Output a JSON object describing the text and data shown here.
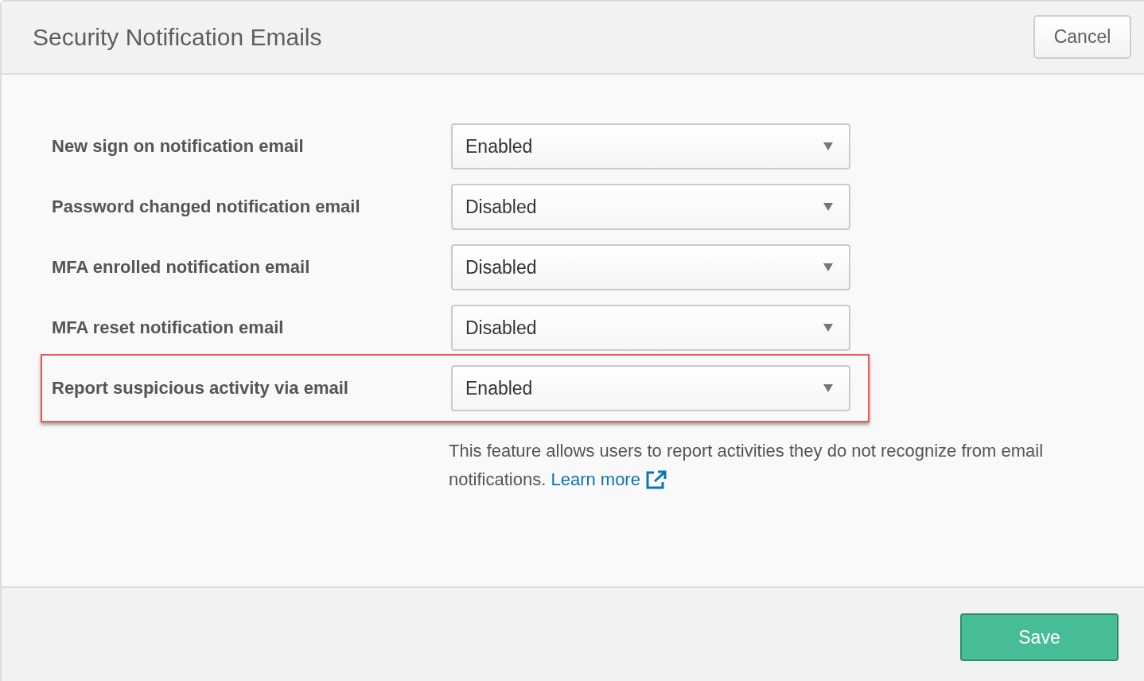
{
  "dialog": {
    "title": "Security Notification Emails",
    "cancel_button": "Cancel",
    "save_button": "Save"
  },
  "settings": [
    {
      "label": "New sign on notification email",
      "value": "Enabled",
      "highlighted": false
    },
    {
      "label": "Password changed notification email",
      "value": "Disabled",
      "highlighted": false
    },
    {
      "label": "MFA enrolled notification email",
      "value": "Disabled",
      "highlighted": false
    },
    {
      "label": "MFA reset notification email",
      "value": "Disabled",
      "highlighted": false
    },
    {
      "label": "Report suspicious activity via email",
      "value": "Enabled",
      "highlighted": true
    }
  ],
  "description": {
    "text": "This feature allows users to report activities they do not recognize from email notifications.",
    "link": "Learn more"
  }
}
